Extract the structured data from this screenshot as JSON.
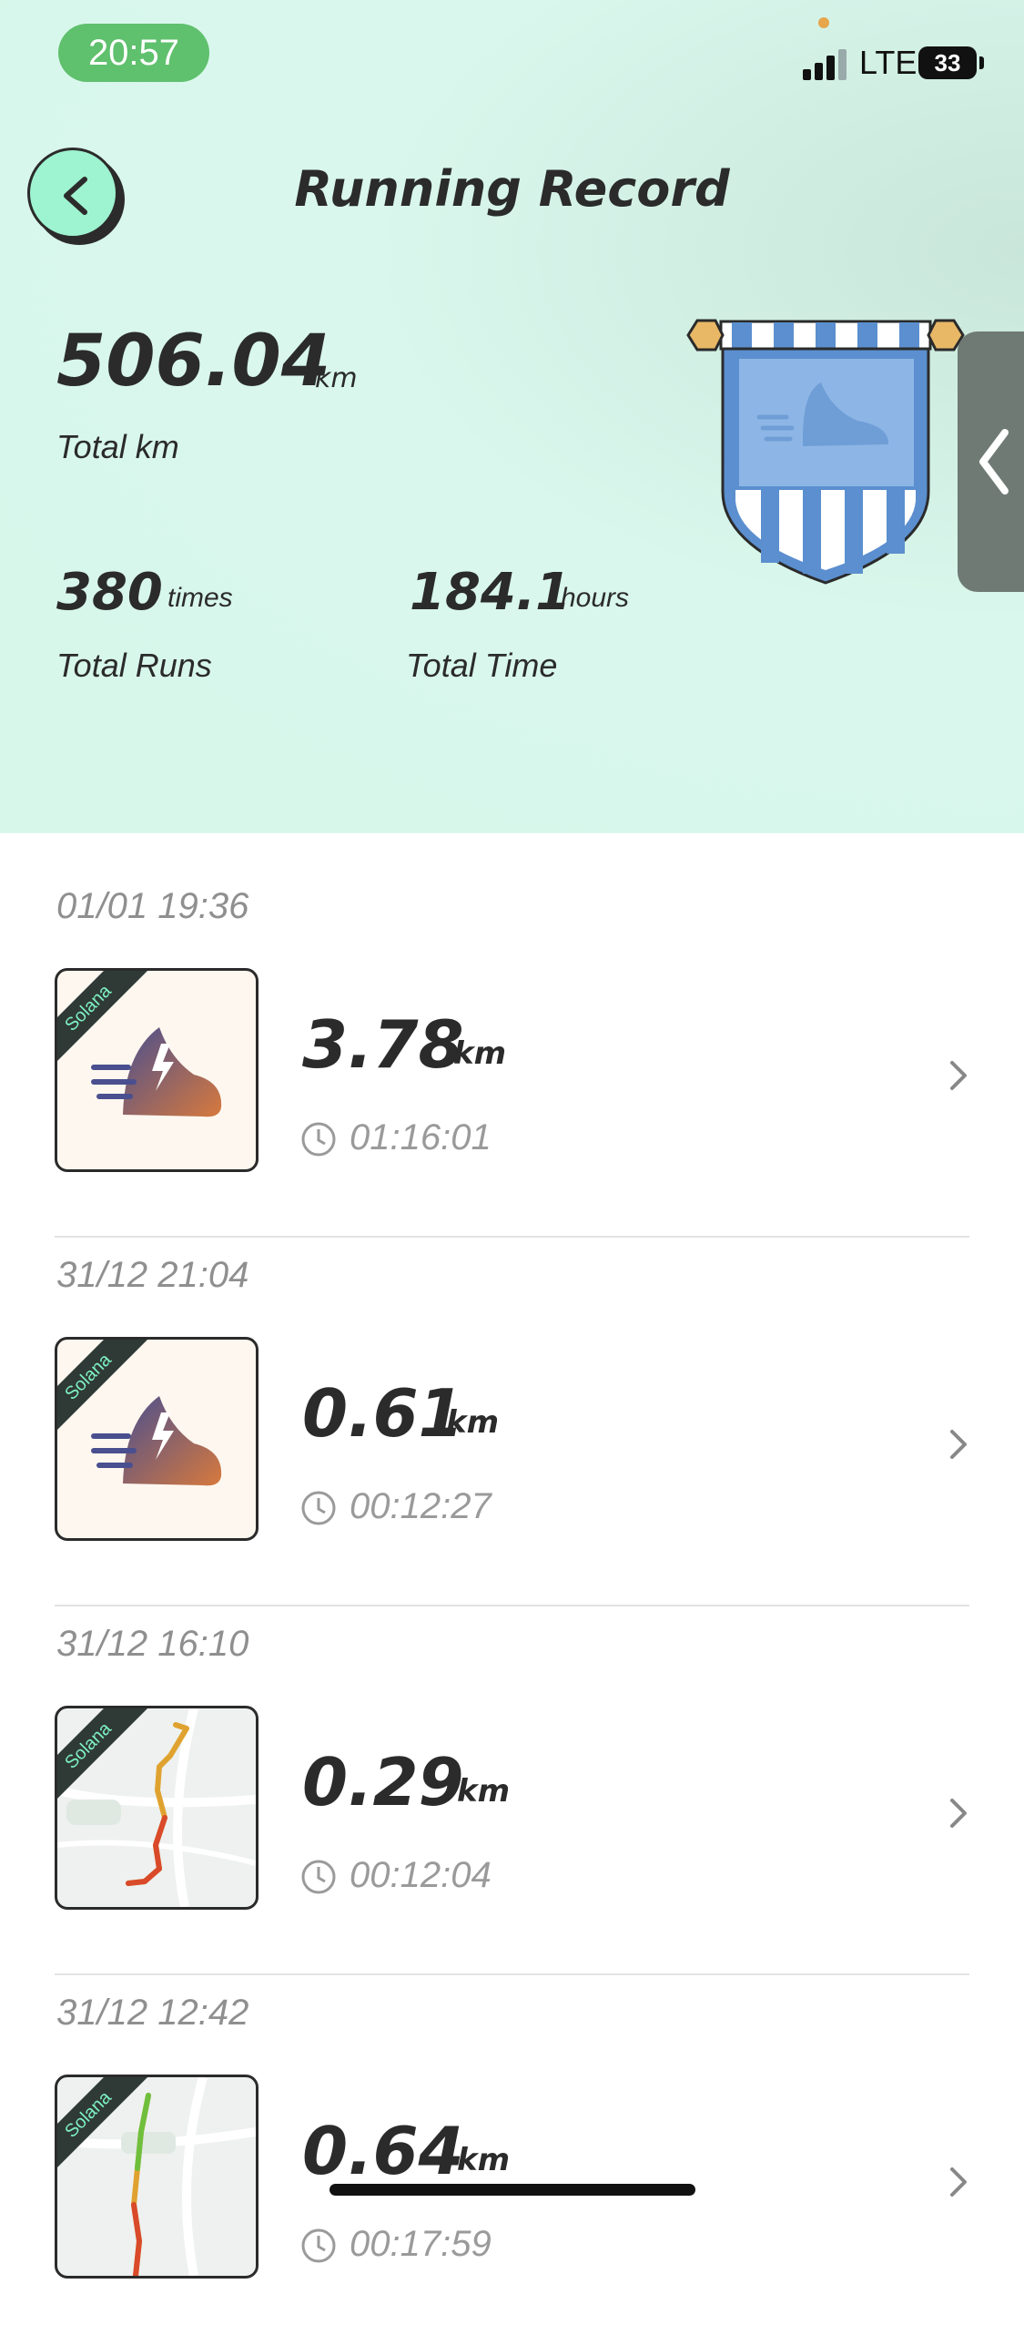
{
  "status_bar": {
    "time": "20:57",
    "network": "LTE",
    "battery": "33"
  },
  "header": {
    "title": "Running Record"
  },
  "summary": {
    "total_km_value": "506.04",
    "total_km_unit": "km",
    "total_km_label": "Total km",
    "total_runs_value": "380",
    "total_runs_unit": "times",
    "total_runs_label": "Total Runs",
    "total_time_value": "184.1",
    "total_time_unit": "hours",
    "total_time_label": "Total Time"
  },
  "records": [
    {
      "date": "01/01  19:36",
      "km": "3.78",
      "unit": "km",
      "duration": "01:16:01",
      "badge": "Solana",
      "thumb": "shoe-icon"
    },
    {
      "date": "31/12  21:04",
      "km": "0.61",
      "unit": "km",
      "duration": "00:12:27",
      "badge": "Solana",
      "thumb": "shoe-icon"
    },
    {
      "date": "31/12  16:10",
      "km": "0.29",
      "unit": "km",
      "duration": "00:12:04",
      "badge": "Solana",
      "thumb": "route-map"
    },
    {
      "date": "31/12  12:42",
      "km": "0.64",
      "unit": "km",
      "duration": "00:17:59",
      "badge": "Solana",
      "thumb": "route-map"
    }
  ],
  "colors": {
    "hero_bg": "#d8f7eb",
    "accent": "#9ef3d0",
    "text": "#2b2b2b",
    "banner_blue": "#5b8fcf"
  }
}
